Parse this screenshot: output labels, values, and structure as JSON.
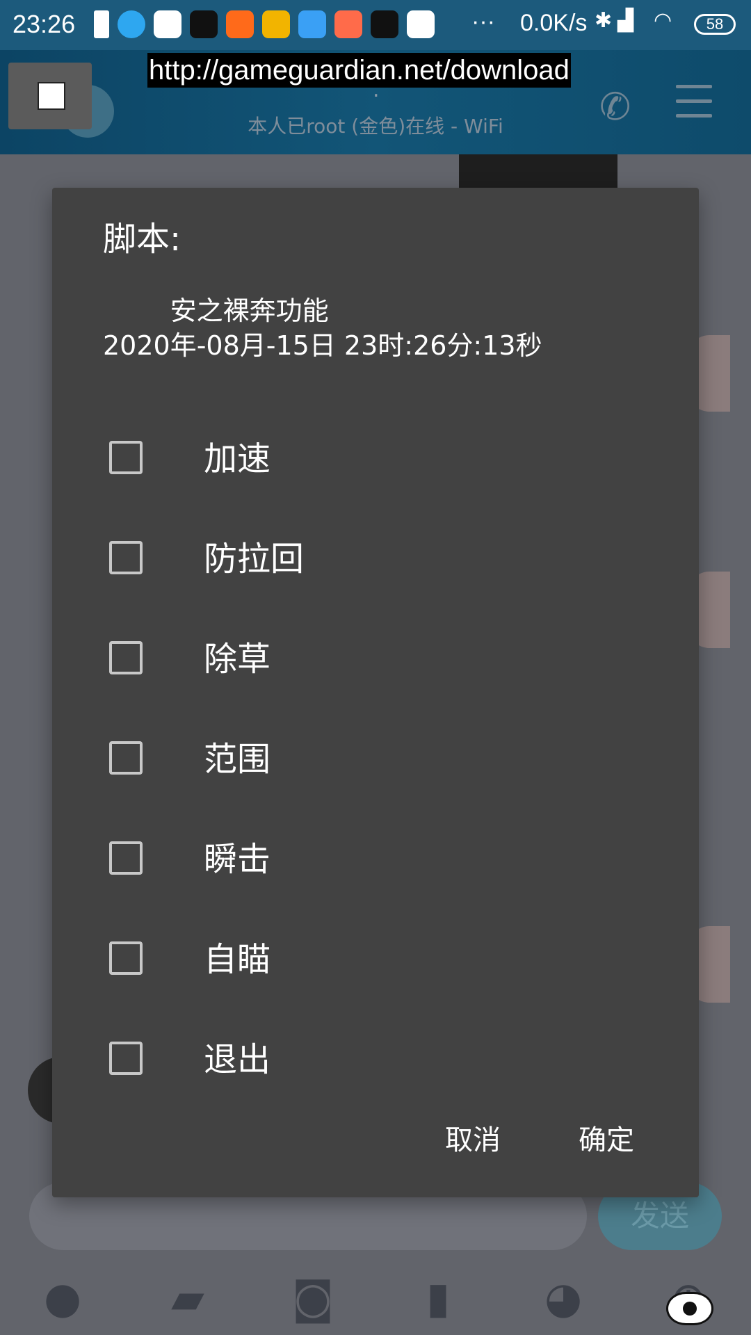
{
  "status_bar": {
    "time": "23:26",
    "net_speed": "0.0K/s",
    "battery": "58",
    "icons": [
      "battery-icon",
      "app-icon-blue",
      "mi-store-icon",
      "tiktok-icon",
      "kuaishou-icon",
      "game-icon",
      "browser-icon",
      "mi-red-icon",
      "capcut-icon",
      "video-icon",
      "more-icon",
      "bluetooth-icon",
      "signal-icon",
      "wifi-icon"
    ]
  },
  "header": {
    "subtitle": "本人已root (金色)在线 - WiFi",
    "dot": "."
  },
  "overlay": {
    "url": "http://gameguardian.net/download"
  },
  "dialog": {
    "title": "脚本:",
    "subtitle": "        安之裸奔功能\n2020年-08月-15日 23时:26分:13秒",
    "options": [
      {
        "label": "加速",
        "checked": false
      },
      {
        "label": "防拉回",
        "checked": false
      },
      {
        "label": "除草",
        "checked": false
      },
      {
        "label": "范围",
        "checked": false
      },
      {
        "label": "瞬击",
        "checked": false
      },
      {
        "label": "自瞄",
        "checked": false
      },
      {
        "label": "退出",
        "checked": false
      }
    ],
    "cancel_label": "取消",
    "ok_label": "确定"
  },
  "chat": {
    "send_label": "发送"
  },
  "colors": {
    "dialog_bg": "#424242",
    "header_bg": "#0c4464",
    "dim_bg": "#62646b"
  }
}
